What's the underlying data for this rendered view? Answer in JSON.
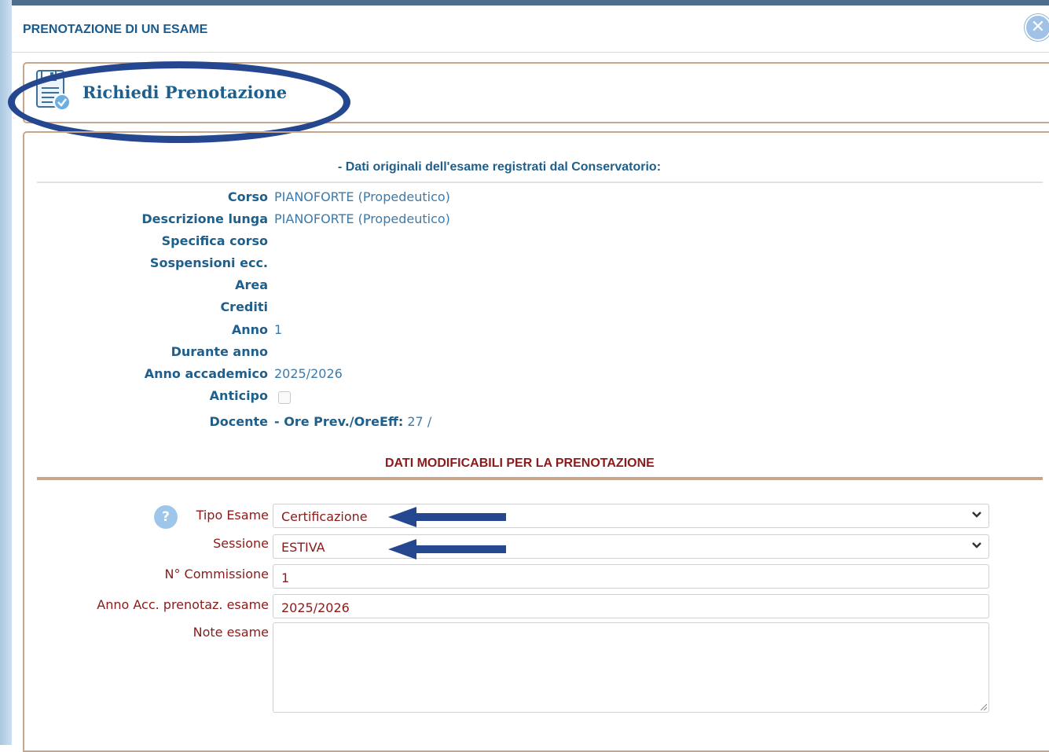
{
  "dialog": {
    "title": "PRENOTAZIONE DI UN ESAME",
    "close_icon": "close-icon"
  },
  "header": {
    "title": "Richiedi Prenotazione",
    "icon": "floppy-document-check-icon"
  },
  "original_data": {
    "heading": "- Dati originali dell'esame registrati dal Conservatorio:",
    "rows": [
      {
        "label": "Corso",
        "value": "PIANOFORTE (Propedeutico)"
      },
      {
        "label": "Descrizione lunga",
        "value": "PIANOFORTE (Propedeutico)"
      },
      {
        "label": "Specifica corso",
        "value": ""
      },
      {
        "label": "Sospensioni ecc.",
        "value": ""
      },
      {
        "label": "Area",
        "value": ""
      },
      {
        "label": "Crediti",
        "value": ""
      },
      {
        "label": "Anno",
        "value": "1"
      },
      {
        "label": "Durante anno",
        "value": ""
      },
      {
        "label": "Anno accademico",
        "value": "2025/2026"
      }
    ],
    "anticipo_label": "Anticipo",
    "anticipo_checked": false,
    "docente_label": "Docente",
    "docente_prefix": "- ",
    "ore_label": "Ore Prev./OreEff:",
    "ore_value": "27 /"
  },
  "editable": {
    "heading": "DATI MODIFICABILI PER LA PRENOTAZIONE",
    "tipo_esame_label": "Tipo Esame",
    "tipo_esame_value": "Certificazione",
    "sessione_label": "Sessione",
    "sessione_value": "ESTIVA",
    "commissione_label": "N° Commissione",
    "commissione_value": "1",
    "anno_acc_label": "Anno Acc. prenotaz. esame",
    "anno_acc_value": "2025/2026",
    "note_label": "Note esame",
    "note_value": ""
  },
  "colors": {
    "label_blue": "#1f5f8b",
    "value_blue": "#3b7bab",
    "form_red": "#8b1a1a",
    "panel_border": "#c8a68b",
    "annotation_navy": "#24478f"
  }
}
